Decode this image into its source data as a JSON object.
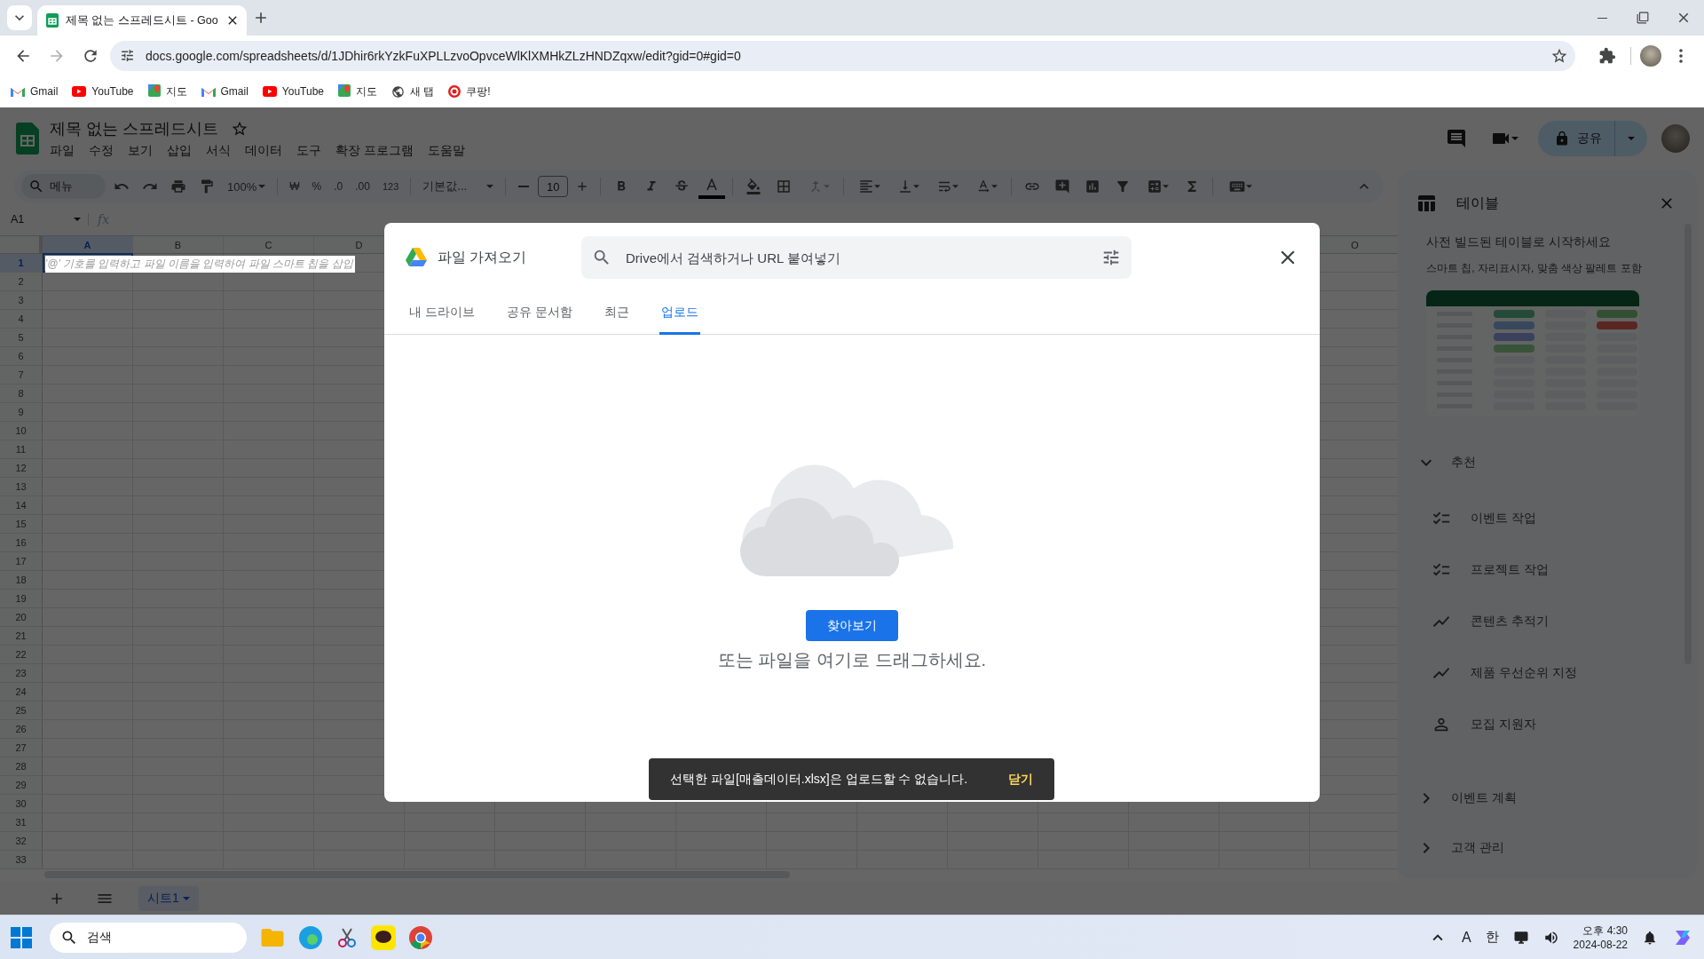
{
  "browser": {
    "tab": {
      "title": "제목 없는 스프레드시트 - Goo",
      "selected": true
    },
    "url": "docs.google.com/spreadsheets/d/1JDhir6rkYzkFuXPLLzvoOpvceWlKlXMHkZLzHNDZqxw/edit?gid=0#gid=0",
    "bookmarks": [
      {
        "label": "Gmail",
        "kind": "gmail"
      },
      {
        "label": "YouTube",
        "kind": "youtube"
      },
      {
        "label": "지도",
        "kind": "maps"
      },
      {
        "label": "Gmail",
        "kind": "gmail"
      },
      {
        "label": "YouTube",
        "kind": "youtube"
      },
      {
        "label": "지도",
        "kind": "maps"
      },
      {
        "label": "새 탭",
        "kind": "globe"
      },
      {
        "label": "쿠팡!",
        "kind": "coupang"
      }
    ]
  },
  "sheets": {
    "title": "제목 없는 스프레드시트",
    "menus": [
      "파일",
      "수정",
      "보기",
      "삽입",
      "서식",
      "데이터",
      "도구",
      "확장 프로그램",
      "도움말"
    ],
    "share_label": "공유",
    "toolbar": {
      "search": "메뉴",
      "zoom": "100%",
      "currency": "₩",
      "percent": "%",
      "decrease_decimals": ".0",
      "increase_decimals": ".00",
      "number_format": "123",
      "font": "기본값...",
      "font_size": "10"
    },
    "name_box": "A1",
    "formula_label": "fx",
    "grid": {
      "columns_left": [
        "A",
        "B",
        "C",
        "D"
      ],
      "columns_right": [
        "O"
      ],
      "rows": [
        "1",
        "2",
        "3",
        "4",
        "5",
        "6",
        "7",
        "8",
        "9",
        "10",
        "11",
        "12",
        "13",
        "14",
        "15",
        "16",
        "17",
        "18",
        "19",
        "20",
        "21",
        "22",
        "23",
        "24",
        "25",
        "26",
        "27",
        "28",
        "29",
        "30",
        "31",
        "32",
        "33"
      ],
      "active_cell": {
        "hint": "'@' 기호를 입력하고 파일 이름을 입력하여 파일 스마트 칩을 삽입",
        "selected": true
      }
    },
    "sheet_tabs": [
      {
        "label": "시트1",
        "selected": true
      }
    ]
  },
  "side_panel": {
    "title": "테이블",
    "heading": "사전 빌드된 테이블로 시작하세요",
    "subheading": "스마트 칩, 자리표시자, 맞춤 색상 팔레트 포함",
    "sections": [
      {
        "label": "추천",
        "expanded": true,
        "items": [
          {
            "label": "이벤트 작업",
            "kind": "checklist"
          },
          {
            "label": "프로젝트 작업",
            "kind": "checklist"
          },
          {
            "label": "콘텐츠 추적기",
            "kind": "trend"
          },
          {
            "label": "제품 우선순위 지정",
            "kind": "trend"
          },
          {
            "label": "모집 지원자",
            "kind": "person"
          }
        ]
      },
      {
        "label": "이벤트 계획",
        "expanded": false
      },
      {
        "label": "고객 관리",
        "expanded": false
      }
    ]
  },
  "dialog": {
    "title": "파일 가져오기",
    "search_placeholder": "Drive에서 검색하거나 URL 붙여넣기",
    "tabs": [
      {
        "label": "내 드라이브",
        "selected": false
      },
      {
        "label": "공유 문서함",
        "selected": false
      },
      {
        "label": "최근",
        "selected": false
      },
      {
        "label": "업로드",
        "selected": true
      }
    ],
    "browse_button": "찾아보기",
    "drop_hint": "또는 파일을 여기로 드래그하세요.",
    "snackbar": {
      "message": "선택한 파일[매출데이터.xlsx]은 업로드할 수 없습니다.",
      "action": "닫기"
    }
  },
  "taskbar": {
    "search": "검색",
    "input_mode": "A",
    "language": "한",
    "time": "오후 4:30",
    "date": "2024-08-22"
  }
}
